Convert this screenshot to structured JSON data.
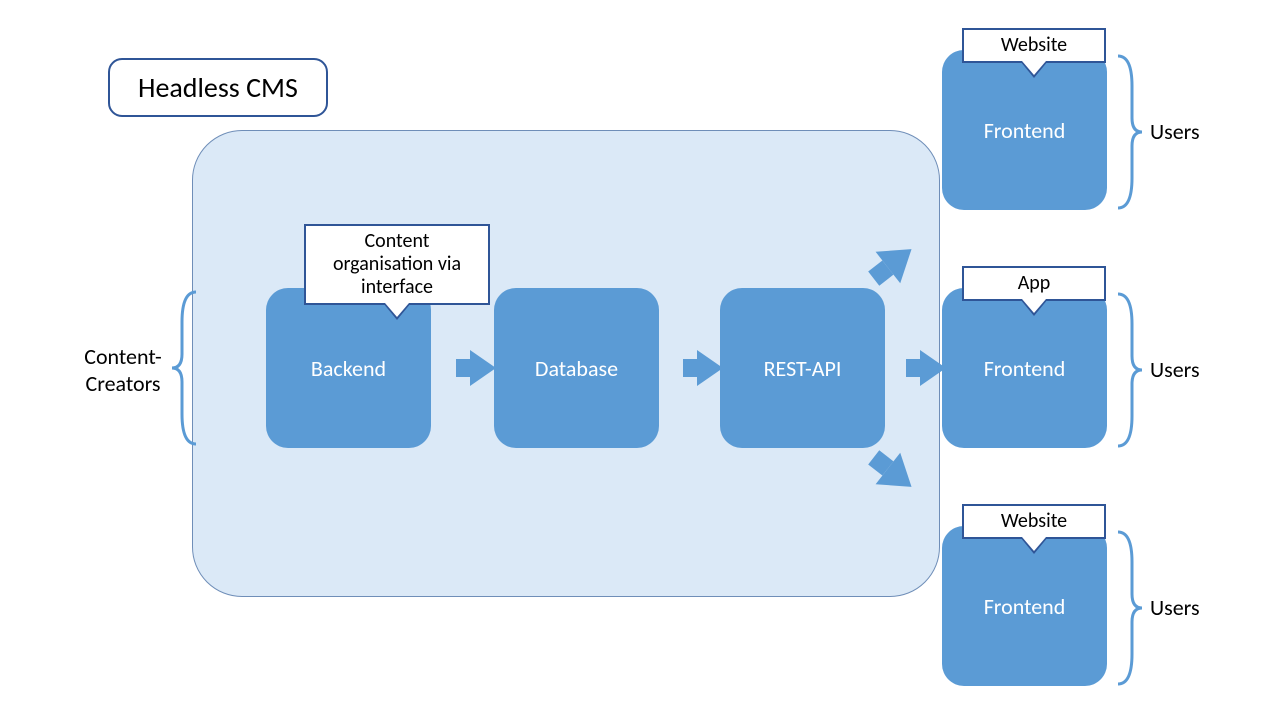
{
  "title": "Headless CMS",
  "left_actor": "Content-\nCreators",
  "container_nodes": {
    "backend": "Backend",
    "backend_callout": "Content\norganisation via\ninterface",
    "database": "Database",
    "restapi": "REST-API"
  },
  "frontends": [
    {
      "callout": "Website",
      "node": "Frontend",
      "audience": "Users"
    },
    {
      "callout": "App",
      "node": "Frontend",
      "audience": "Users"
    },
    {
      "callout": "Website",
      "node": "Frontend",
      "audience": "Users"
    }
  ]
}
